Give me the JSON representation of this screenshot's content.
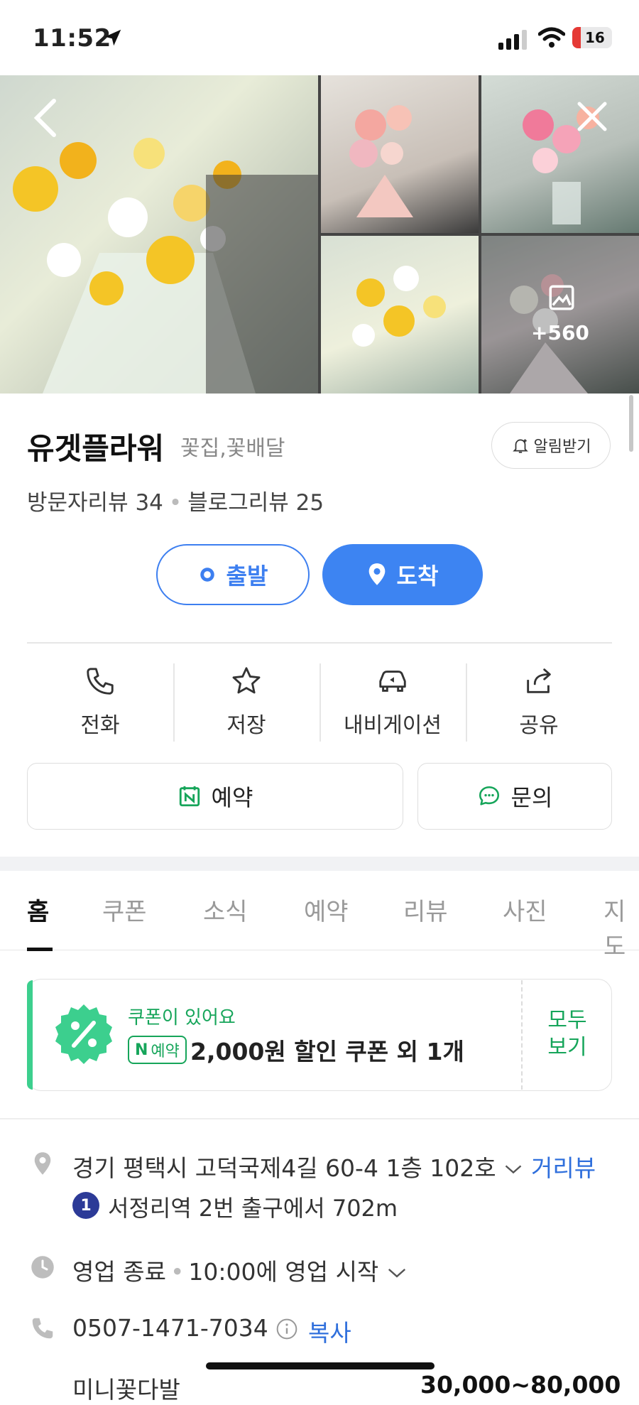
{
  "status": {
    "time": "11:52",
    "battery": "16"
  },
  "gallery": {
    "more_count": "+560"
  },
  "place": {
    "name": "유겟플라워",
    "category": "꽃집,꽃배달",
    "alarm_label": "알림받기",
    "visitor_reviews": "방문자리뷰 34",
    "blog_reviews": "블로그리뷰 25"
  },
  "route": {
    "depart": "출발",
    "arrive": "도착"
  },
  "actions": [
    {
      "label": "전화",
      "icon": "phone-icon"
    },
    {
      "label": "저장",
      "icon": "star-icon"
    },
    {
      "label": "내비게이션",
      "icon": "car-icon"
    },
    {
      "label": "공유",
      "icon": "share-icon"
    }
  ],
  "buttons": {
    "reserve": "예약",
    "inquiry": "문의"
  },
  "tabs": [
    "홈",
    "쿠폰",
    "소식",
    "예약",
    "리뷰",
    "사진",
    "지도"
  ],
  "coupon": {
    "title": "쿠폰이 있어요",
    "badge": "예약",
    "text": "2,000원 할인 쿠폰 외 1개",
    "all_line1": "모두",
    "all_line2": "보기"
  },
  "info": {
    "address": "경기 평택시 고덕국제4길 60-4 1층 102호",
    "street_view": "거리뷰",
    "subway_line": "1",
    "subway_text": "서정리역 2번 출구에서 702m",
    "hours_status": "영업 종료",
    "hours_next": "10:00에 영업 시작",
    "phone": "0507-1471-7034",
    "copy": "복사",
    "menu_peek": "미니꽃다발",
    "price_peek": "30,000~80,000"
  },
  "colors": {
    "accent_blue": "#3d84f2",
    "naver_green": "#16a55a",
    "coupon_bar": "#3ccf8e"
  }
}
